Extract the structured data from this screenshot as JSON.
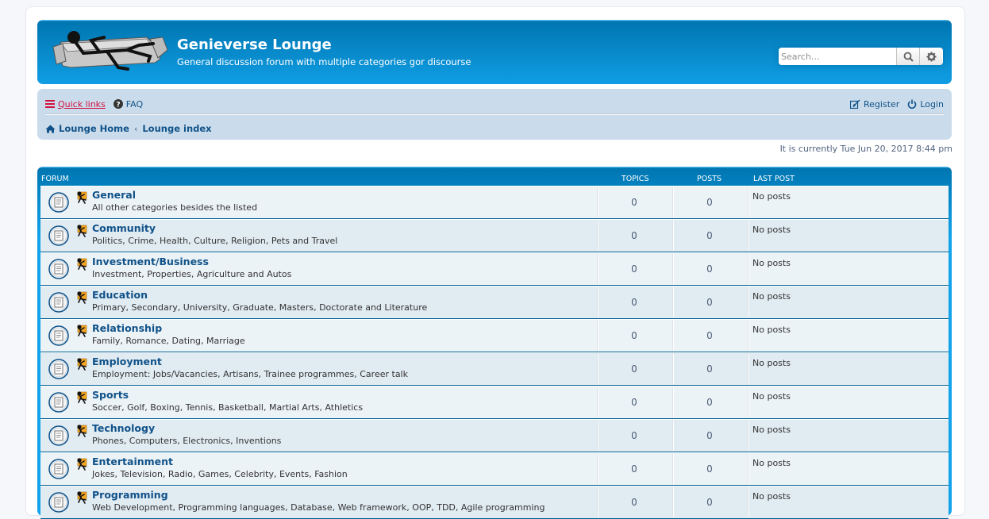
{
  "header": {
    "site_title": "Genieverse Lounge",
    "site_description": "General discussion forum with multiple categories gor discourse",
    "search_placeholder": "Search…",
    "logo_icon": "stickman-on-couch-logo"
  },
  "navbar": {
    "quick_links": "Quick links",
    "faq": "FAQ",
    "register": "Register",
    "login": "Login",
    "breadcrumb": [
      "Lounge Home",
      "Lounge index"
    ]
  },
  "datetime": "It is currently Tue Jun 20, 2017 8:44 pm",
  "table": {
    "headers": {
      "forum": "Forum",
      "topics": "Topics",
      "posts": "Posts",
      "last_post": "Last post"
    },
    "forums": [
      {
        "title": "General",
        "description": "All other categories besides the listed",
        "topics": "0",
        "posts": "0",
        "last_post": "No posts"
      },
      {
        "title": "Community",
        "description": "Politics, Crime, Health, Culture, Religion, Pets and Travel",
        "topics": "0",
        "posts": "0",
        "last_post": "No posts"
      },
      {
        "title": "Investment/Business",
        "description": "Investment, Properties, Agriculture and Autos",
        "topics": "0",
        "posts": "0",
        "last_post": "No posts"
      },
      {
        "title": "Education",
        "description": "Primary, Secondary, University, Graduate, Masters, Doctorate and Literature",
        "topics": "0",
        "posts": "0",
        "last_post": "No posts"
      },
      {
        "title": "Relationship",
        "description": "Family, Romance, Dating, Marriage",
        "topics": "0",
        "posts": "0",
        "last_post": "No posts"
      },
      {
        "title": "Employment",
        "description": "Employment: Jobs/Vacancies, Artisans, Trainee programmes, Career talk",
        "topics": "0",
        "posts": "0",
        "last_post": "No posts"
      },
      {
        "title": "Sports",
        "description": "Soccer, Golf, Boxing, Tennis, Basketball, Martial Arts, Athletics",
        "topics": "0",
        "posts": "0",
        "last_post": "No posts"
      },
      {
        "title": "Technology",
        "description": "Phones, Computers, Electronics, Inventions",
        "topics": "0",
        "posts": "0",
        "last_post": "No posts"
      },
      {
        "title": "Entertainment",
        "description": "Jokes, Television, Radio, Games, Celebrity, Events, Fashion",
        "topics": "0",
        "posts": "0",
        "last_post": "No posts"
      },
      {
        "title": "Programming",
        "description": "Web Development, Programming languages, Database, Web framework, OOP, TDD, Agile programming",
        "topics": "0",
        "posts": "0",
        "last_post": "No posts"
      }
    ]
  }
}
